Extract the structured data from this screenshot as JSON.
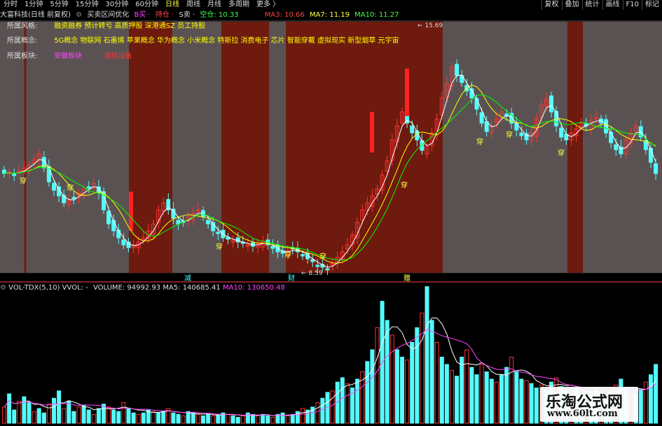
{
  "toolbar": {
    "periods": [
      "分时",
      "1分钟",
      "5分钟",
      "15分钟",
      "30分钟",
      "60分钟",
      "日线",
      "周线",
      "月线",
      "多周期",
      "更多 〉"
    ],
    "active_period": "日线",
    "right_buttons": [
      "复权",
      "叠加",
      "统计",
      "画线",
      "F10",
      "标记"
    ]
  },
  "legend": {
    "stock": "大富科技(日线 前复权)",
    "indicator": "买卖区间优化",
    "buy": "B买 ·",
    "hold": "持仓 ·",
    "sell": "S卖 ·",
    "empty": "空仓: 10.33",
    "ma3": "MA3: 10.66",
    "ma7": "MA7: 11.19",
    "ma10": "MA10: 11.27"
  },
  "info": {
    "style_label": "所属风格:",
    "style_value": "融资融券 预计转亏 高质押股 深港通SZ 员工持股",
    "concept_label": "所属概念:",
    "concept_value": "5G概念 物联网 石墨烯 苹果概念 华为概念 小米概念 特斯拉 消费电子 芯片 智能穿戴 虚拟现实 新型烟草 元宇宙",
    "sector_label": "所属板块:",
    "sector_value1": "安徽板块",
    "sector_value2": "通信设备"
  },
  "annotations": {
    "high": "15.69",
    "low": "8.59",
    "chuan": "穿",
    "date_marks": [
      "减",
      "财",
      "赠"
    ]
  },
  "volume": {
    "legend": "VOL-TDX(5,10) VVOL: -",
    "vol": "VOLUME: 94992.93",
    "ma5": "MA5: 140685.41",
    "ma10": "MA10: 130650.48"
  },
  "watermark": {
    "title": "乐淘公式网",
    "url": "www.60lt.com"
  },
  "colors": {
    "up": "#ff3333",
    "down": "#54fcfc",
    "ma_white": "#ffffff",
    "ma_yellow": "#ffff00",
    "ma_green": "#00ff00",
    "vol_ma10": "#ff44ff",
    "bg_red": "#6e1a0e",
    "bg_gray": "#5a5252"
  }
}
